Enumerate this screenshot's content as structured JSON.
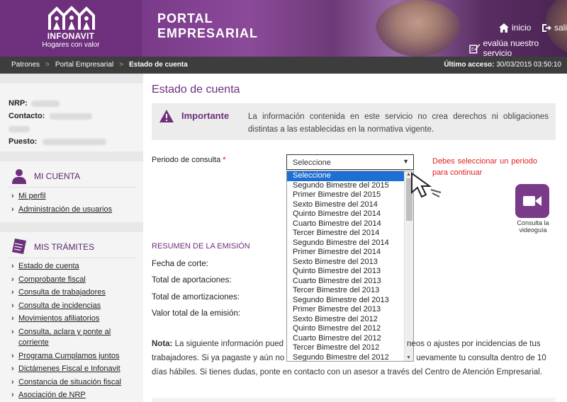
{
  "header": {
    "logo_name": "INFONAVIT",
    "logo_tagline": "Hogares con valor",
    "portal_title_line1": "PORTAL",
    "portal_title_line2": "EMPRESARIAL",
    "link_inicio": "inicio",
    "link_salir": "salir",
    "link_evalua": "evalúa nuestro servicio"
  },
  "breadcrumb": {
    "items": [
      "Patrones",
      "Portal Empresarial",
      "Estado de cuenta"
    ],
    "separator": ">",
    "last_access_label": "Último acceso:",
    "last_access_value": "30/03/2015 03:50:10"
  },
  "sidebar": {
    "user": {
      "nrp_label": "NRP:",
      "contacto_label": "Contacto:",
      "puesto_label": "Puesto:"
    },
    "cuenta": {
      "title": "MI CUENTA",
      "items": [
        "Mi perfil",
        "Administración de usuarios"
      ]
    },
    "tramites": {
      "title": "MIS TRÁMITES",
      "items": [
        "Estado de cuenta",
        "Comprobante fiscal",
        "Consulta de trabajadores",
        "Consulta de incidencias",
        "Movimientos afiliatorios",
        "Consulta, aclara y ponte al",
        "corriente",
        "Programa Cumplamos juntos",
        "Dictámenes Fiscal e Infonavit",
        "Constancia de situación fiscal",
        "Asociación de NRP"
      ]
    }
  },
  "main": {
    "title": "Estado de cuenta",
    "important_label": "Importante",
    "important_text": "La información contenida en este servicio no crea derechos ni obligaciones distintas a las establecidas en la normativa vigente.",
    "period_label": "Periodo de consulta",
    "required_mark": "*",
    "select_value": "Seleccione",
    "error_text": "Debes seleccionar un periodo para continuar",
    "dropdown_options": [
      "Seleccione",
      "Segundo Bimestre del 2015",
      "Primer Bimestre del 2015",
      "Sexto Bimestre del 2014",
      "Quinto Bimestre del 2014",
      "Cuarto Bimestre del 2014",
      "Tercer Bimestre del 2014",
      "Segundo Bimestre del 2014",
      "Primer Bimestre del 2014",
      "Sexto Bimestre del 2013",
      "Quinto Bimestre del 2013",
      "Cuarto Bimestre del 2013",
      "Tercer Bimestre del 2013",
      "Segundo Bimestre del 2013",
      "Primer Bimestre del 2013",
      "Sexto Bimestre del 2012",
      "Quinto Bimestre del 2012",
      "Cuarto Bimestre del 2012",
      "Tercer Bimestre del 2012",
      "Segundo Bimestre del 2012"
    ],
    "video_label": "Consulta la videoguía",
    "summary_title": "RESUMEN DE LA EMISIÓN",
    "summary_rows": [
      "Fecha de corte:",
      "Total de aportaciones:",
      "Total de amortizaciones:",
      "Valor total de la emisión:"
    ],
    "nota_label": "Nota:",
    "nota_line1": "La siguiente información pued",
    "nota_line1b": "neos o ajustes por incidencias de tus",
    "nota_line2": "trabajadores. Si ya pagaste y aún no",
    "nota_line2b": "uevamente tu consulta dentro de 10",
    "nota_line3": "días hábiles. Si tienes dudas, ponte en contacto con un asesor a través del Centro de Atención Empresarial."
  },
  "colors": {
    "brand_purple": "#6e2f7c",
    "breadcrumb_bar": "#3d3d3d",
    "error_red": "#e02020",
    "selected_option": "#1e6fd4"
  }
}
